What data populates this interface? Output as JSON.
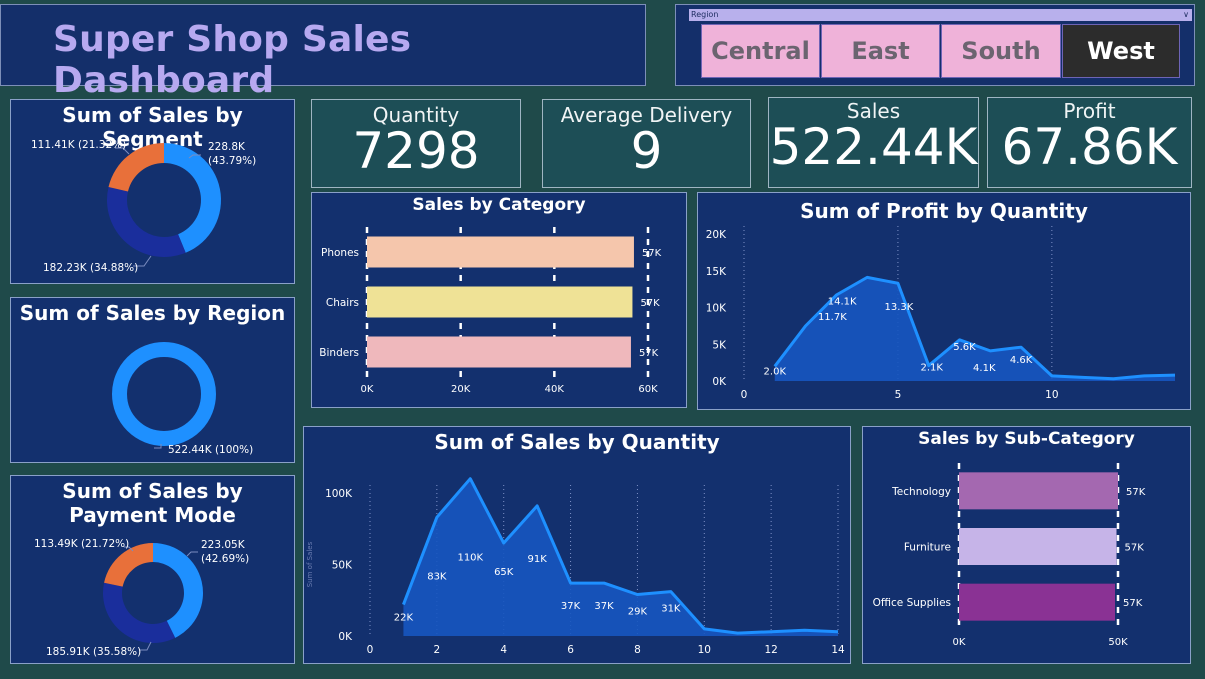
{
  "title": "Super Shop Sales Dashboard",
  "slicer": {
    "label": "Region",
    "options": [
      "Central",
      "East",
      "South",
      "West"
    ],
    "selected": "West"
  },
  "kpis": {
    "quantity": {
      "label": "Quantity",
      "value": "7298"
    },
    "delivery": {
      "label": "Average Delivery",
      "value": "9"
    },
    "sales": {
      "label": "Sales",
      "value": "522.44K"
    },
    "profit": {
      "label": "Profit",
      "value": "67.86K"
    }
  },
  "colors": {
    "background": "#1f4a4a",
    "panel": "#13306e",
    "accent_blue": "#1e90ff",
    "navy": "#1a2e9c",
    "orange": "#e8703a",
    "title_purple": "#b7a9f0"
  },
  "chart_data": [
    {
      "id": "segment",
      "type": "pie",
      "title": "Sum of Sales by Segment",
      "slices": [
        {
          "value": 228.8,
          "label": "228.8K\n(43.79%)",
          "color": "#1e90ff"
        },
        {
          "value": 182.23,
          "label": "182.23K (34.88%)",
          "color": "#1a2e9c"
        },
        {
          "value": 111.41,
          "label": "111.41K (21.32%)",
          "color": "#e8703a"
        }
      ]
    },
    {
      "id": "region",
      "type": "pie",
      "title": "Sum of Sales by Region",
      "slices": [
        {
          "value": 522.44,
          "label": "522.44K (100%)",
          "color": "#1e90ff"
        }
      ]
    },
    {
      "id": "payment",
      "type": "pie",
      "title": "Sum of Sales by Payment Mode",
      "slices": [
        {
          "value": 223.05,
          "label": "223.05K\n(42.69%)",
          "color": "#1e90ff"
        },
        {
          "value": 185.91,
          "label": "185.91K (35.58%)",
          "color": "#1a2e9c"
        },
        {
          "value": 113.49,
          "label": "113.49K (21.72%)",
          "color": "#e8703a"
        }
      ]
    },
    {
      "id": "category",
      "type": "bar",
      "title": "Sales by Category",
      "categories": [
        "Phones",
        "Chairs",
        "Binders"
      ],
      "values": [
        57,
        57,
        57
      ],
      "value_labels": [
        "57K",
        "57K",
        "57K"
      ],
      "colors": [
        "#f5c6ac",
        "#efe296",
        "#efb8bc"
      ],
      "xticks": [
        "0K",
        "20K",
        "40K",
        "60K"
      ],
      "xlim": [
        0,
        60
      ]
    },
    {
      "id": "profit_qty",
      "type": "area",
      "title": "Sum of Profit by Quantity",
      "x": [
        1,
        2,
        3,
        4,
        5,
        6,
        7,
        8,
        9,
        10,
        11,
        12,
        13,
        14
      ],
      "y": [
        2.0,
        7.5,
        11.7,
        14.1,
        13.3,
        2.1,
        5.6,
        4.1,
        4.6,
        0.7,
        0.5,
        0.3,
        0.7,
        0.8
      ],
      "point_labels": {
        "1": "2.0K",
        "3": "11.7K",
        "4": "14.1K",
        "5": "13.3K",
        "6": "2.1K",
        "7": "5.6K",
        "8": "4.1K",
        "9": "4.6K"
      },
      "yticks": [
        "0K",
        "5K",
        "10K",
        "15K",
        "20K"
      ],
      "xticks": [
        "0",
        "5",
        "10"
      ],
      "ylim": [
        0,
        20
      ],
      "xlim": [
        0,
        14
      ]
    },
    {
      "id": "sales_qty",
      "type": "area",
      "title": "Sum of Sales by Quantity",
      "ylabel": "Sum of Sales",
      "x": [
        1,
        2,
        3,
        4,
        5,
        6,
        7,
        8,
        9,
        10,
        11,
        12,
        13,
        14
      ],
      "y": [
        22,
        83,
        110,
        65,
        91,
        37,
        37,
        29,
        31,
        5,
        2,
        3,
        4,
        3
      ],
      "point_labels": {
        "1": "22K",
        "2": "83K",
        "3": "110K",
        "4": "65K",
        "5": "91K",
        "6": "37K",
        "7": "37K",
        "8": "29K",
        "9": "31K"
      },
      "yticks": [
        "0K",
        "50K",
        "100K"
      ],
      "xticks": [
        "0",
        "2",
        "4",
        "6",
        "8",
        "10",
        "12",
        "14"
      ],
      "ylim": [
        0,
        100
      ],
      "xlim": [
        0,
        14
      ]
    },
    {
      "id": "subcategory",
      "type": "bar",
      "title": "Sales by Sub-Category",
      "categories": [
        "Technology",
        "Furniture",
        "Office Supplies"
      ],
      "values": [
        57,
        57,
        57
      ],
      "value_labels": [
        "57K",
        "57K",
        "57K"
      ],
      "colors": [
        "#a468b0",
        "#c6b4e8",
        "#8a3294"
      ],
      "xticks": [
        "0K",
        "50K"
      ],
      "xlim": [
        0,
        50
      ]
    }
  ]
}
